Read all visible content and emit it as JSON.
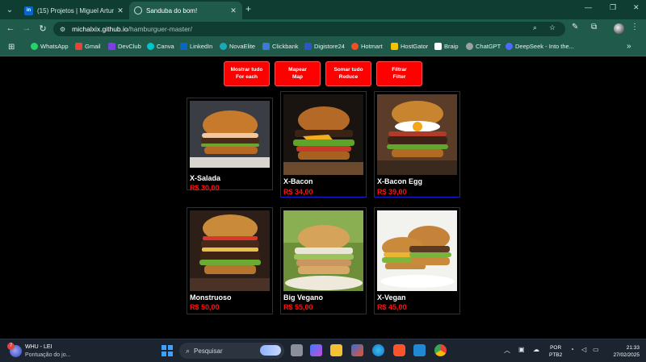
{
  "browser": {
    "tabs": [
      {
        "title": "(15) Projetos | Miguel Artur | Li"
      },
      {
        "title": "Sanduba do bom!"
      }
    ],
    "url_host": "michalxix.github.io",
    "url_path": "/hamburguer-master/",
    "bookmarks": [
      {
        "label": "WhatsApp",
        "color": "#25d366"
      },
      {
        "label": "Gmail",
        "color": "#ea4335"
      },
      {
        "label": "DevClub",
        "color": "#7b3fe4"
      },
      {
        "label": "Canva",
        "color": "#00c4cc"
      },
      {
        "label": "LinkedIn",
        "color": "#0a66c2"
      },
      {
        "label": "NovaElite",
        "color": "#1aa9b8"
      },
      {
        "label": "Clickbank",
        "color": "#3a7bd5"
      },
      {
        "label": "Digistore24",
        "color": "#2d55c8"
      },
      {
        "label": "Hotmart",
        "color": "#f04e23"
      },
      {
        "label": "HostGator",
        "color": "#f4c400"
      },
      {
        "label": "Braip",
        "color": "#ffffff"
      },
      {
        "label": "ChatGPT",
        "color": "#9aa0a6"
      },
      {
        "label": "DeepSeek - Into the...",
        "color": "#4d6bfe"
      }
    ]
  },
  "page": {
    "buttons": [
      {
        "line1": "Mostrar tudo",
        "line2": "For each"
      },
      {
        "line1": "Mapear",
        "line2": "Map"
      },
      {
        "line1": "Somar tudo",
        "line2": "Reduce"
      },
      {
        "line1": "Filtrar",
        "line2": "Filter"
      }
    ],
    "products": [
      {
        "name": "X-Salada",
        "price": "R$ 30,00"
      },
      {
        "name": "X-Bacon",
        "price": "R$ 34,00"
      },
      {
        "name": "X-Bacon Egg",
        "price": "R$ 39,00"
      },
      {
        "name": "Monstruoso",
        "price": "R$ 50,00"
      },
      {
        "name": "Big Vegano",
        "price": "R$ 55,00"
      },
      {
        "name": "X-Vegan",
        "price": "R$ 45,00"
      }
    ]
  },
  "taskbar": {
    "weather_badge": "7",
    "weather_title": "WHU - LEI",
    "weather_sub": "Pontuação do jo...",
    "search_placeholder": "Pesquisar",
    "lang_top": "POR",
    "lang_bottom": "PTB2",
    "time": "21:33",
    "date": "27/02/2025"
  },
  "colors": {
    "accent": "#ff0000",
    "price": "#ff1111",
    "card_border": "#1b1bd6",
    "chrome": "#1f5a4a"
  }
}
